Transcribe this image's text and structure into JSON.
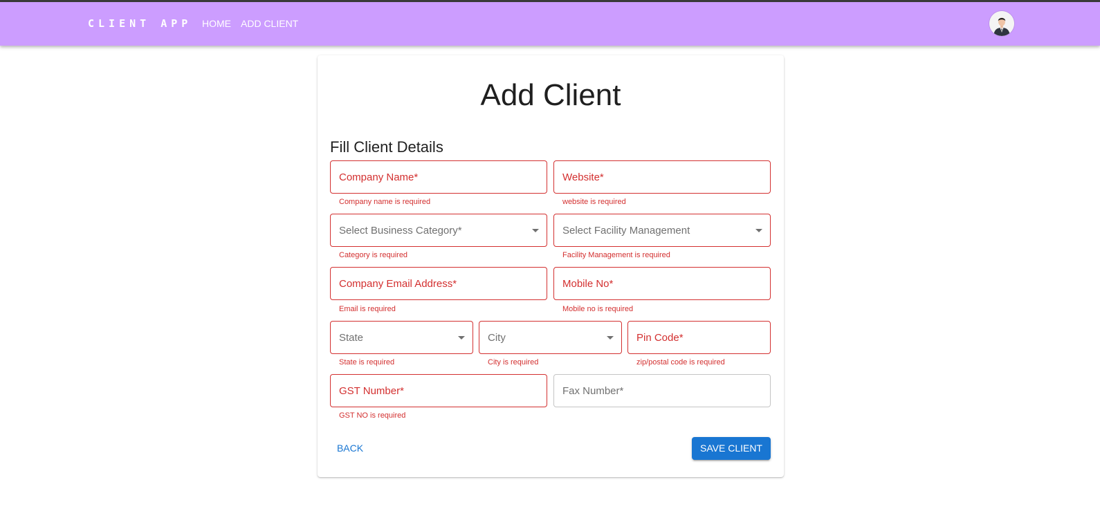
{
  "app": {
    "brand": "CLIENT APP",
    "nav": [
      "HOME",
      "ADD CLIENT"
    ]
  },
  "form": {
    "title": "Add Client",
    "subtitle": "Fill Client Details",
    "fields": {
      "company_name": {
        "placeholder": "Company Name*",
        "error": "Company name is required"
      },
      "website": {
        "placeholder": "Website*",
        "error": "website is required"
      },
      "business_category": {
        "placeholder": "Select Business Category*",
        "error": "Category is required"
      },
      "facility_management": {
        "placeholder": "Select Facility Management",
        "error": "Facility Management is required"
      },
      "company_email": {
        "placeholder": "Company Email Address*",
        "error": "Email is required"
      },
      "mobile_no": {
        "placeholder": "Mobile No*",
        "error": "Mobile no is required"
      },
      "state": {
        "placeholder": "State",
        "error": "State is required"
      },
      "city": {
        "placeholder": "City",
        "error": "City is required"
      },
      "pin_code": {
        "placeholder": "Pin Code*",
        "error": "zip/postal code is required"
      },
      "gst_number": {
        "placeholder": "GST Number*",
        "error": "GST NO is required"
      },
      "fax_number": {
        "placeholder": "Fax Number*"
      }
    },
    "actions": {
      "back": "BACK",
      "save": "SAVE CLIENT"
    }
  },
  "colors": {
    "appbar": "#cc9dff",
    "error": "#d32f2f",
    "primary": "#1976d2"
  },
  "icons": {
    "avatar": "user-avatar-icon",
    "dropdown": "arrow-drop-down-icon"
  }
}
